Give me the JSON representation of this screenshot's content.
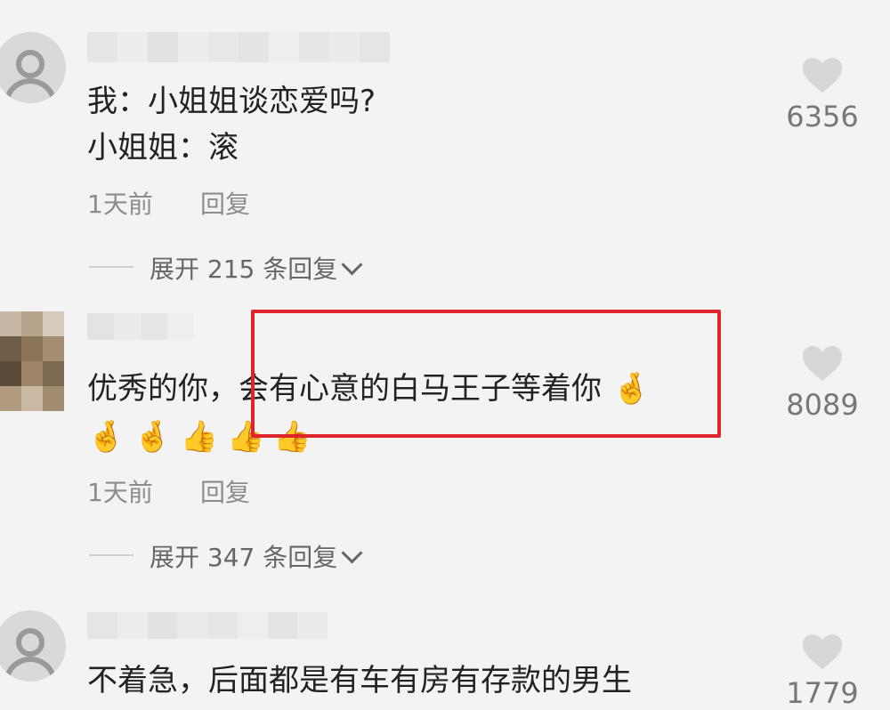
{
  "comments": [
    {
      "text_lines": [
        "我：小姐姐谈恋爱吗?",
        "小姐姐：滚"
      ],
      "time": "1天前",
      "reply_label": "回复",
      "likes": "6356",
      "expand_label": "展开 215 条回复"
    },
    {
      "text_lines": [
        "优秀的你，会有心意的白马王子等着你"
      ],
      "emojis": [
        "🤞",
        "🤞",
        "🤞",
        "👍",
        "👍",
        "👍"
      ],
      "time": "1天前",
      "reply_label": "回复",
      "likes": "8089",
      "expand_label": "展开 347 条回复"
    },
    {
      "text_lines": [
        "不着急，后面都是有车有房有存款的男生"
      ],
      "likes": "1779"
    }
  ],
  "icons": {
    "like": "heart-icon",
    "avatar": "default-avatar-icon",
    "expand": "chevron-down-icon"
  },
  "colors": {
    "highlight_border": "#e0242b",
    "background": "#f3f3f3",
    "meta_text": "#8c8c8c"
  }
}
